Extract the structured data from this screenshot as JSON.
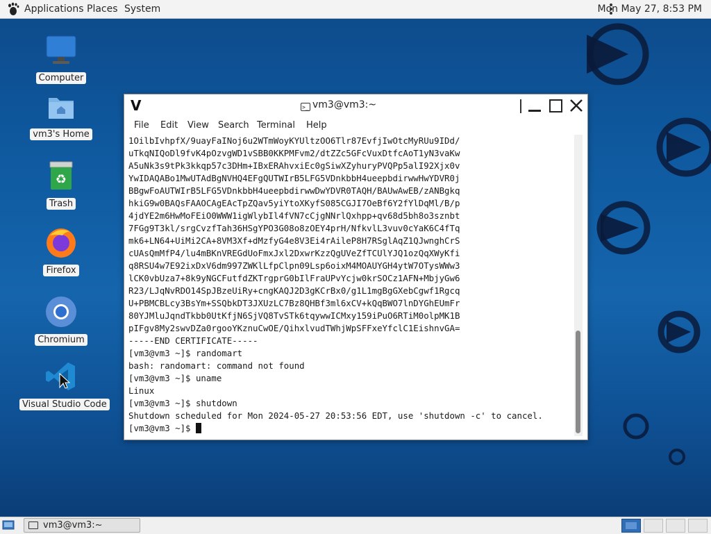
{
  "top_panel": {
    "applications": "Applications",
    "places": "Places",
    "system": "System",
    "clock": "Mon May 27,  8:53 PM"
  },
  "desktop": {
    "icons": [
      {
        "label": "Computer"
      },
      {
        "label": "vm3's Home"
      },
      {
        "label": "Trash"
      },
      {
        "label": "Firefox"
      },
      {
        "label": "Chromium"
      },
      {
        "label": "Visual Studio Code"
      }
    ]
  },
  "terminal": {
    "title": "vm3@vm3:~",
    "menu": [
      "File",
      "Edit",
      "View",
      "Search",
      "Terminal",
      "Help"
    ],
    "lines": [
      "1OilbIvhpfX/9uayFaINoj6u2WTmWoyKYUltzOO6Tlr87EvfjIwOtcMyRUu9IDd/",
      "uTkqNIQoDl9fvK4pOzvgWD1vSBB0KKPMFvm2/dtZZc5GFcVuxDtfcAoT1yN3vaKw",
      "A5uNk3s9tPk3kkqp57c3DHm+IBxERAhvxiEc0gSiwXZyhuryPVQPp5alI92Xjx0v",
      "YwIDAQABo1MwUTAdBgNVHQ4EFgQUTWIrB5LFG5VDnkbbH4ueepbdirwwHwYDVR0j",
      "BBgwFoAUTWIrB5LFG5VDnkbbH4ueepbdirwwDwYDVR0TAQH/BAUwAwEB/zANBgkq",
      "hkiG9w0BAQsFAAOCAgEAcTpZQav5yiYtoXKyfS085CGJI7OeBf6Y2fYlDqMl/B/p",
      "4jdYE2m6HwMoFEiO0WWW1igWlybIl4fVN7cCjgNNrlQxhpp+qv68d5bh8o3sznbt",
      "7FGg9T3kl/srgCvzfTah36HSgYPO3G08o8zOEY4prH/NfkvlL3vuv0cYaK6C4fTq",
      "mk6+LN64+UiMi2CA+8VM3Xf+dMzfyG4e8V3Ei4rAileP8H7RSglAqZ1QJwnghCrS",
      "cUAsQmMfP4/lu4mBKnVREGdUoFmxJxl2DxwrKzzQgUVeZfTCUlYJQ1ozQqXWyKfi",
      "q8RSU4w7E92ixDxV6dm997ZWKlLfpClpn09Lsp6oixM4MOAUYGH4ytW7OTysWWw3",
      "lCK0vbUza7+8k9yNGCFutfdZKTrgprG0bIlFraUPvYcjw0krSOCz1AFN+MbjyGw6",
      "R23/LJqNvRDO14SpJBzeUiRy+cngKAQJ2D3gKCrBx0/g1L1mgBgGXebCgwf1Rgcq",
      "U+PBMCBLcy3BsYm+SSQbkDT3JXUzLC7Bz8QHBf3ml6xCV+kQqBWO7lnDYGhEUmFr",
      "80YJMluJqndTkbb0UtKfjN6SjVQ8TvSTk6tqywwICMxy159iPuO6RTiM0olpMK1B",
      "pIFgv8My2swvDZa0rgooYKznuCwOE/QihxlvudTWhjWpSFFxeYfclC1EishnvGA=",
      "-----END CERTIFICATE-----",
      "[vm3@vm3 ~]$ randomart",
      "bash: randomart: command not found",
      "[vm3@vm3 ~]$ uname",
      "Linux",
      "[vm3@vm3 ~]$ shutdown",
      "Shutdown scheduled for Mon 2024-05-27 20:53:56 EDT, use 'shutdown -c' to cancel."
    ],
    "prompt": "[vm3@vm3 ~]$ "
  },
  "bottom_panel": {
    "task_label": "vm3@vm3:~"
  },
  "colors": {
    "desktop_bg": "#0f5aa0",
    "panel_bg": "#f3f3f3",
    "workspace_active": "#2f6db5"
  }
}
